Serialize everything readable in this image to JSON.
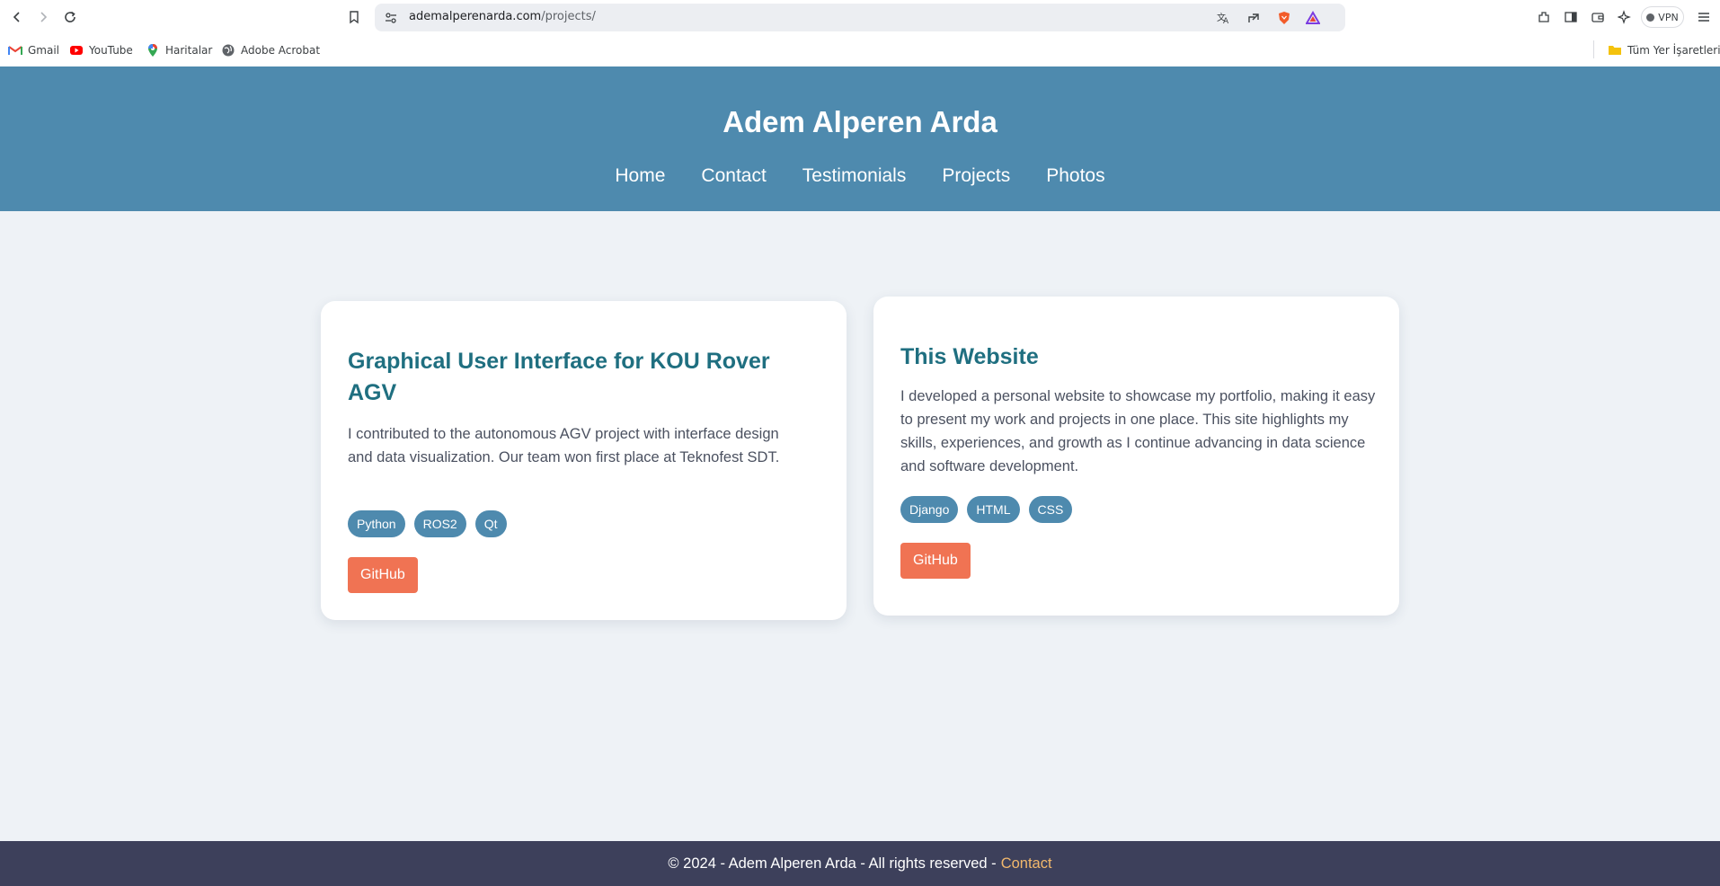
{
  "browser": {
    "url_host": "ademalperenarda.com",
    "url_path": "/projects/",
    "vpn_label": "VPN",
    "icons": [
      "back-icon",
      "forward-icon",
      "reload-icon",
      "bookmark-icon",
      "site-settings-icon",
      "translate-icon",
      "share-icon",
      "brave-shield-icon",
      "brave-rewards-icon",
      "extensions-icon",
      "sidebar-icon",
      "wallet-icon",
      "leo-icon",
      "menu-icon"
    ]
  },
  "bookmarks": {
    "items": [
      {
        "label": "Gmail",
        "icon": "gmail-icon"
      },
      {
        "label": "YouTube",
        "icon": "youtube-icon"
      },
      {
        "label": "Haritalar",
        "icon": "maps-icon"
      },
      {
        "label": "Adobe Acrobat",
        "icon": "globe-icon"
      }
    ],
    "all_bookmarks": "Tüm Yer İşaretleri"
  },
  "header": {
    "title": "Adem Alperen Arda",
    "nav": [
      "Home",
      "Contact",
      "Testimonials",
      "Projects",
      "Photos"
    ]
  },
  "projects": [
    {
      "title": "Graphical User Interface for KOU Rover AGV",
      "description": "I contributed to the autonomous AGV project with interface design and data visualization. Our team won first place at Teknofest SDT.",
      "tags": [
        "Python",
        "ROS2",
        "Qt"
      ],
      "button": "GitHub"
    },
    {
      "title": "This Website",
      "description": "I developed a personal website to showcase my portfolio, making it easy to present my work and projects in one place. This site highlights my skills, experiences, and growth as I continue advancing in data science and software development.",
      "tags": [
        "Django",
        "HTML",
        "CSS"
      ],
      "button": "GitHub"
    }
  ],
  "footer": {
    "text": "© 2024 - Adem Alperen Arda - All rights reserved -",
    "link": "Contact"
  },
  "colors": {
    "header_bg": "#4e8aae",
    "card_title": "#1f6f80",
    "tag_bg": "#4e8aae",
    "button_bg": "#f07353",
    "footer_bg": "#3d405b",
    "footer_link": "#f2b86c",
    "page_bg": "#eef2f6"
  }
}
